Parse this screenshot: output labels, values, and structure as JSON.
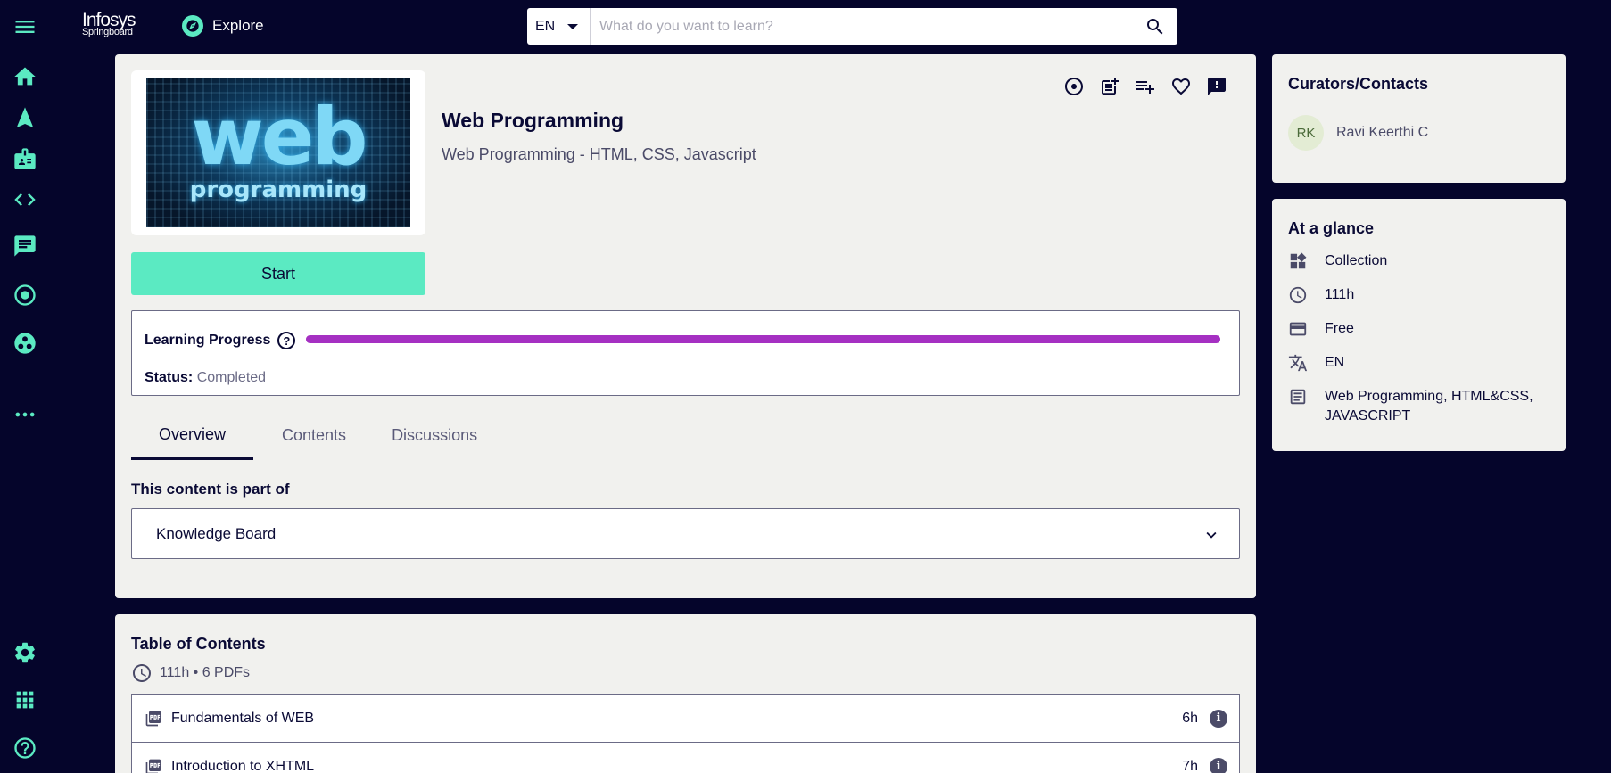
{
  "brand": {
    "line1": "Infosys",
    "line2": "Springboard"
  },
  "nav": {
    "explore_label": "Explore"
  },
  "search": {
    "lang": "EN",
    "placeholder": "What do you want to learn?"
  },
  "course": {
    "title": "Web Programming",
    "subtitle": "Web Programming - HTML, CSS, Javascript",
    "thumb_text_big": "web",
    "thumb_text_small": "programming",
    "start_label": "Start"
  },
  "progress": {
    "label": "Learning Progress",
    "help": "?",
    "value": 1.0,
    "status_label": "Status:",
    "status_value": "Completed",
    "color": "#a530c2"
  },
  "tabs": [
    {
      "label": "Overview",
      "active": true
    },
    {
      "label": "Contents",
      "active": false
    },
    {
      "label": "Discussions",
      "active": false
    }
  ],
  "part_of": {
    "heading": "This content is part of",
    "item": "Knowledge Board"
  },
  "toc": {
    "title": "Table of Contents",
    "meta": "111h • 6 PDFs",
    "items": [
      {
        "name": "Fundamentals of WEB",
        "duration": "6h"
      },
      {
        "name": "Introduction to XHTML",
        "duration": "7h"
      }
    ]
  },
  "curators": {
    "title": "Curators/Contacts",
    "initials": "RK",
    "name": "Ravi Keerthi C"
  },
  "glance": {
    "title": "At a glance",
    "items": [
      {
        "icon": "collection-icon",
        "text": "Collection"
      },
      {
        "icon": "clock-icon",
        "text": "111h"
      },
      {
        "icon": "credit-card-icon",
        "text": "Free"
      },
      {
        "icon": "translate-icon",
        "text": "EN"
      },
      {
        "icon": "subject-icon",
        "text": "Web Programming, HTML&CSS, JAVASCRIPT"
      }
    ]
  },
  "colors": {
    "background": "#05052b",
    "accent": "#5beac2",
    "card": "#f1f1ee"
  }
}
